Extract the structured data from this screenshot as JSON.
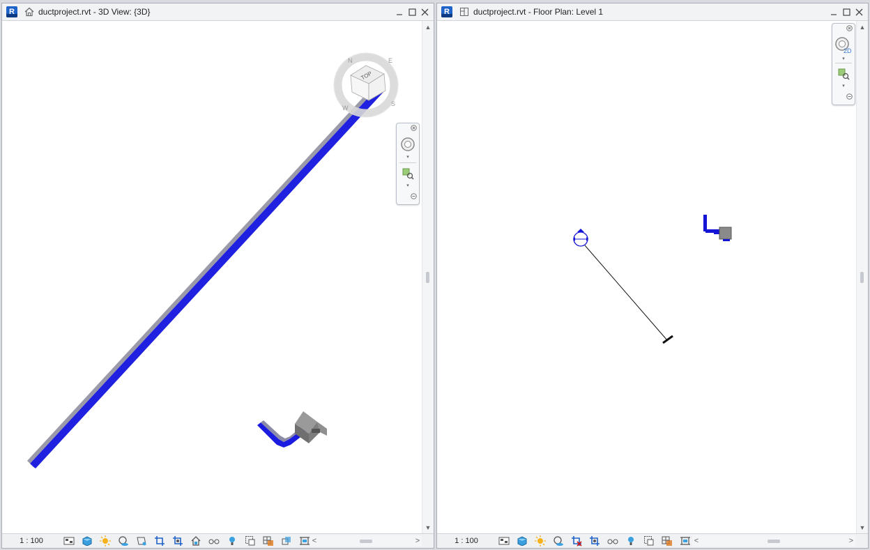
{
  "left_window": {
    "title": "ductproject.rvt - 3D View: {3D}",
    "app_icon_letter": "R",
    "view_icon": "home-icon",
    "scale": "1 : 100",
    "viewcube": {
      "face_label": "TOP",
      "compass": [
        "N",
        "E",
        "S",
        "W"
      ]
    },
    "status_icons": [
      "detail-level-icon",
      "visual-style-icon",
      "sun-path-icon",
      "shadows-icon",
      "rendering-icon",
      "crop-view-icon",
      "show-crop-region-icon",
      "lock-3d-view-icon",
      "temporary-hide-isolate-icon",
      "reveal-hidden-elements-icon",
      "worksharing-display-icon",
      "temporary-view-properties-icon",
      "analytical-model-icon",
      "highlight-displacement-icon"
    ]
  },
  "right_window": {
    "title": "ductproject.rvt - Floor Plan: Level 1",
    "app_icon_letter": "R",
    "view_icon": "floor-plan-icon",
    "scale": "1 : 100",
    "wheel_badge": "2D",
    "status_icons": [
      "detail-level-icon",
      "visual-style-icon",
      "sun-path-icon",
      "shadows-icon",
      "crop-view-icon",
      "show-crop-region-icon",
      "temporary-hide-isolate-icon",
      "reveal-hidden-elements-icon",
      "worksharing-display-icon",
      "temporary-view-properties-icon",
      "analytical-model-icon",
      "highlight-displacement-icon"
    ]
  },
  "colors": {
    "duct_blue": "#1414d6",
    "duct_gray": "#8a8a8a",
    "accent": "#1f62c8"
  }
}
